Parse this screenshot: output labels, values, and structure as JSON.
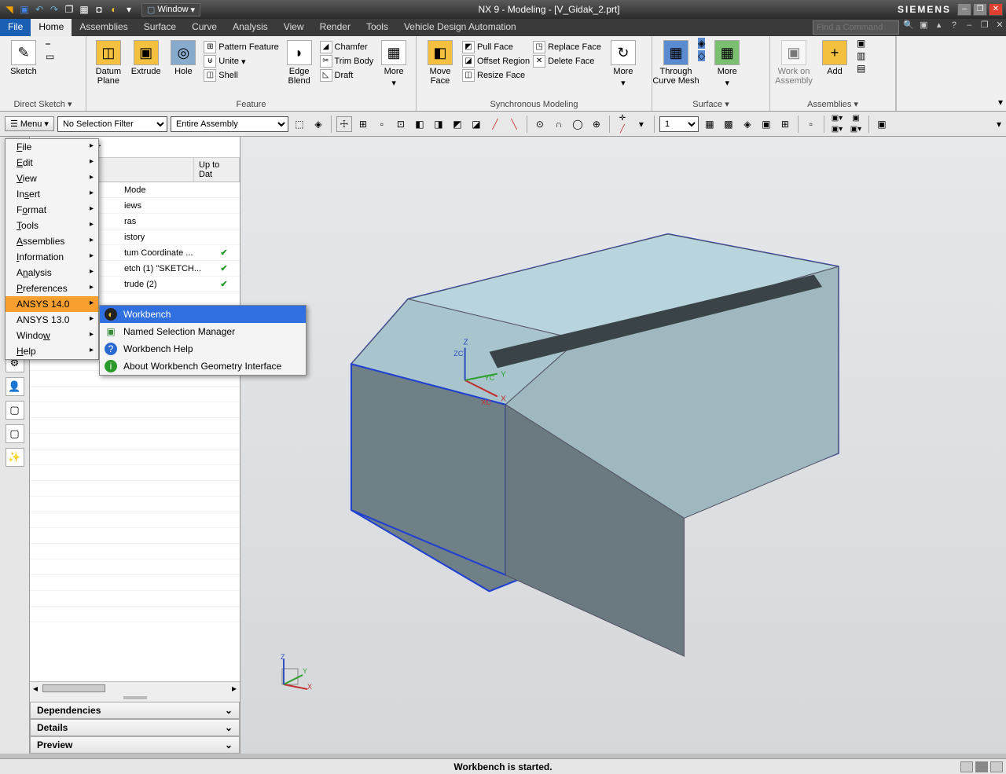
{
  "titlebar": {
    "window_dd": "Window",
    "title": "NX 9 - Modeling - [V_Gidak_2.prt]",
    "brand": "SIEMENS"
  },
  "tabs": {
    "file": "File",
    "items": [
      "Home",
      "Assemblies",
      "Surface",
      "Curve",
      "Analysis",
      "View",
      "Render",
      "Tools",
      "Vehicle Design Automation"
    ],
    "find_placeholder": "Find a Command"
  },
  "ribbon": {
    "direct_sketch": {
      "sketch": "Sketch",
      "label": "Direct Sketch"
    },
    "feature": {
      "datum": "Datum\nPlane",
      "extrude": "Extrude",
      "hole": "Hole",
      "pattern": "Pattern Feature",
      "unite": "Unite",
      "shell": "Shell",
      "edge_blend": "Edge\nBlend",
      "chamfer": "Chamfer",
      "trim": "Trim Body",
      "draft": "Draft",
      "more": "More",
      "label": "Feature"
    },
    "sync": {
      "move_face": "Move\nFace",
      "pull": "Pull Face",
      "offset": "Offset Region",
      "resize": "Resize Face",
      "replace": "Replace Face",
      "delete": "Delete Face",
      "more": "More",
      "label": "Synchronous Modeling"
    },
    "surface": {
      "mesh": "Through\nCurve Mesh",
      "more": "More",
      "label": "Surface"
    },
    "assemblies": {
      "work": "Work on\nAssembly",
      "add": "Add",
      "label": "Assemblies"
    }
  },
  "toolbar": {
    "menu": "Menu",
    "filter": "No Selection Filter",
    "scope": "Entire Assembly",
    "num": "1"
  },
  "navigator": {
    "title_suffix": "ator",
    "col_uptodate": "Up to Dat",
    "rows": [
      {
        "name": "Mode",
        "ck": ""
      },
      {
        "name": "iews",
        "ck": ""
      },
      {
        "name": "ras",
        "ck": ""
      },
      {
        "name": "istory",
        "ck": ""
      },
      {
        "name": "tum Coordinate ...",
        "ck": "✔"
      },
      {
        "name": "etch (1) \"SKETCH...",
        "ck": "✔"
      },
      {
        "name": "trude (2)",
        "ck": "✔"
      }
    ],
    "sections": {
      "deps": "Dependencies",
      "details": "Details",
      "preview": "Preview"
    }
  },
  "main_menu": {
    "items": [
      {
        "label": "File",
        "ul": 0,
        "arrow": true
      },
      {
        "label": "Edit",
        "ul": 0,
        "arrow": true
      },
      {
        "label": "View",
        "ul": 0,
        "arrow": true
      },
      {
        "label": "Insert",
        "ul": 2,
        "arrow": true
      },
      {
        "label": "Format",
        "ul": 1,
        "arrow": true
      },
      {
        "label": "Tools",
        "ul": 0,
        "arrow": true
      },
      {
        "label": "Assemblies",
        "ul": 0,
        "arrow": true
      },
      {
        "label": "Information",
        "ul": 0,
        "arrow": true
      },
      {
        "label": "Analysis",
        "ul": 1,
        "arrow": true
      },
      {
        "label": "Preferences",
        "ul": 0,
        "arrow": true
      },
      {
        "label": "ANSYS 14.0",
        "ul": -1,
        "arrow": true,
        "hov": true
      },
      {
        "label": "ANSYS 13.0",
        "ul": -1,
        "arrow": true
      },
      {
        "label": "Window",
        "ul": 5,
        "arrow": true
      },
      {
        "label": "Help",
        "ul": 0,
        "arrow": true
      }
    ]
  },
  "ansys_submenu": {
    "items": [
      {
        "icon": "◐",
        "label": "Workbench",
        "sel": true,
        "color": "#e0b020"
      },
      {
        "icon": "▣",
        "label": "Named Selection Manager",
        "color": "#3a8a3a"
      },
      {
        "icon": "?",
        "label": "Workbench Help",
        "color": "#2a6ad0"
      },
      {
        "icon": "i",
        "label": "About Workbench Geometry Interface",
        "color": "#2a9a2a"
      }
    ]
  },
  "status": {
    "text": "Workbench is started."
  }
}
